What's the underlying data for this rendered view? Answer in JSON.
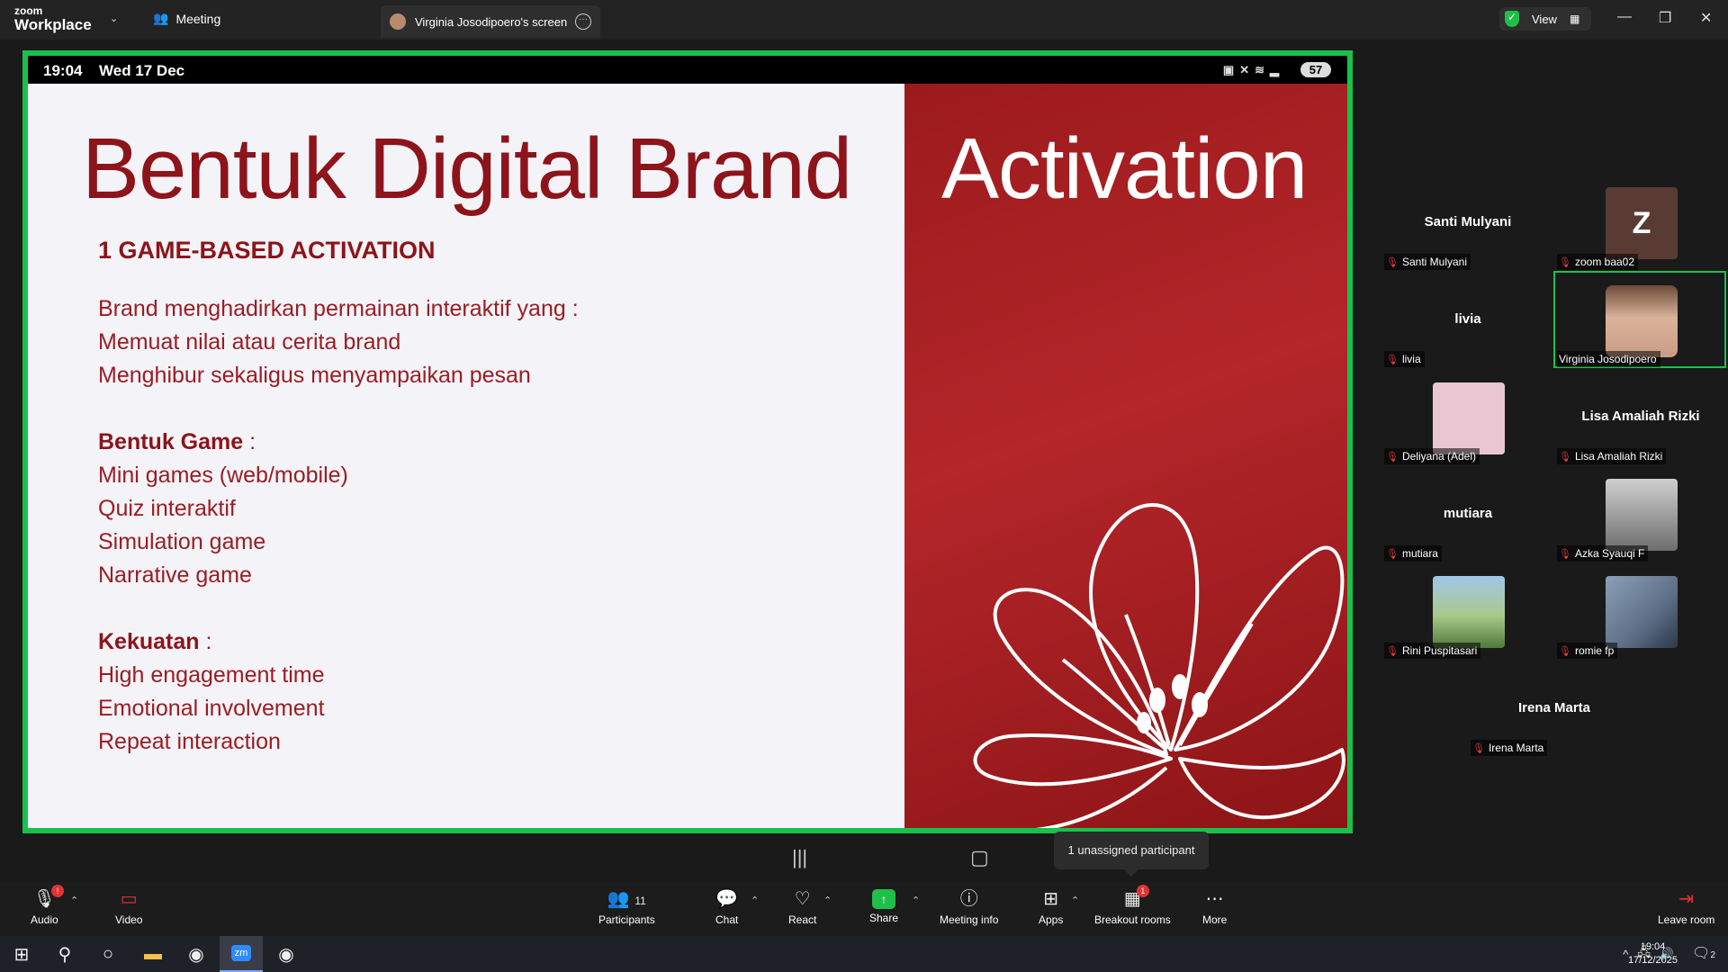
{
  "titlebar": {
    "logo_top": "zoom",
    "logo_bottom": "Workplace",
    "meeting_tab": "Meeting",
    "screen_tab": "Virginia Josodipoero's screen",
    "view_label": "View"
  },
  "phone_status": {
    "time": "19:04",
    "date": "Wed 17 Dec",
    "battery": "57"
  },
  "slide": {
    "title_part1": "Bentuk Digital Brand",
    "title_part2": "Activation",
    "subheading": "1 GAME-BASED ACTIVATION",
    "intro_lines": [
      "Brand menghadirkan permainan interaktif yang :",
      "Memuat nilai atau cerita brand",
      "Menghibur sekaligus menyampaikan pesan"
    ],
    "section1_title": "Bentuk Game",
    "section1_colon": " :",
    "section1_items": [
      "Mini games (web/mobile)",
      "Quiz interaktif",
      "Simulation game",
      "Narrative game"
    ],
    "section2_title": "Kekuatan",
    "section2_colon": " :",
    "section2_items": [
      "High engagement time",
      "Emotional involvement",
      "Repeat interaction"
    ]
  },
  "participants": [
    {
      "display": "Santi Mulyani",
      "label": "Santi Mulyani"
    },
    {
      "display": "Z",
      "label": "zoom baa02"
    },
    {
      "display": "livia",
      "label": "livia"
    },
    {
      "display": "",
      "label": "Virginia Josodipoero"
    },
    {
      "display": "",
      "label": "Deliyana (Adel)"
    },
    {
      "display": "Lisa Amaliah Rizki",
      "label": "Lisa Amaliah Rizki"
    },
    {
      "display": "mutiara",
      "label": "mutiara"
    },
    {
      "display": "",
      "label": "Azka Syauqi F"
    },
    {
      "display": "",
      "label": "Rini Puspitasari"
    },
    {
      "display": "",
      "label": "romie fp"
    },
    {
      "display": "Irena Marta",
      "label": "Irena Marta"
    }
  ],
  "tooltip": "1 unassigned participant",
  "toolbar": {
    "audio": "Audio",
    "video": "Video",
    "participants": "Participants",
    "participants_count": "11",
    "chat": "Chat",
    "react": "React",
    "share": "Share",
    "meeting_info": "Meeting info",
    "apps": "Apps",
    "breakout": "Breakout rooms",
    "breakout_badge": "1",
    "more": "More",
    "leave": "Leave room"
  },
  "taskbar": {
    "time": "19:04",
    "date": "17/12/2025",
    "notif_count": "2"
  },
  "colors": {
    "share_border": "#17c24b",
    "slide_red": "#9c1a1c",
    "title_dark_red": "#8c141a"
  }
}
